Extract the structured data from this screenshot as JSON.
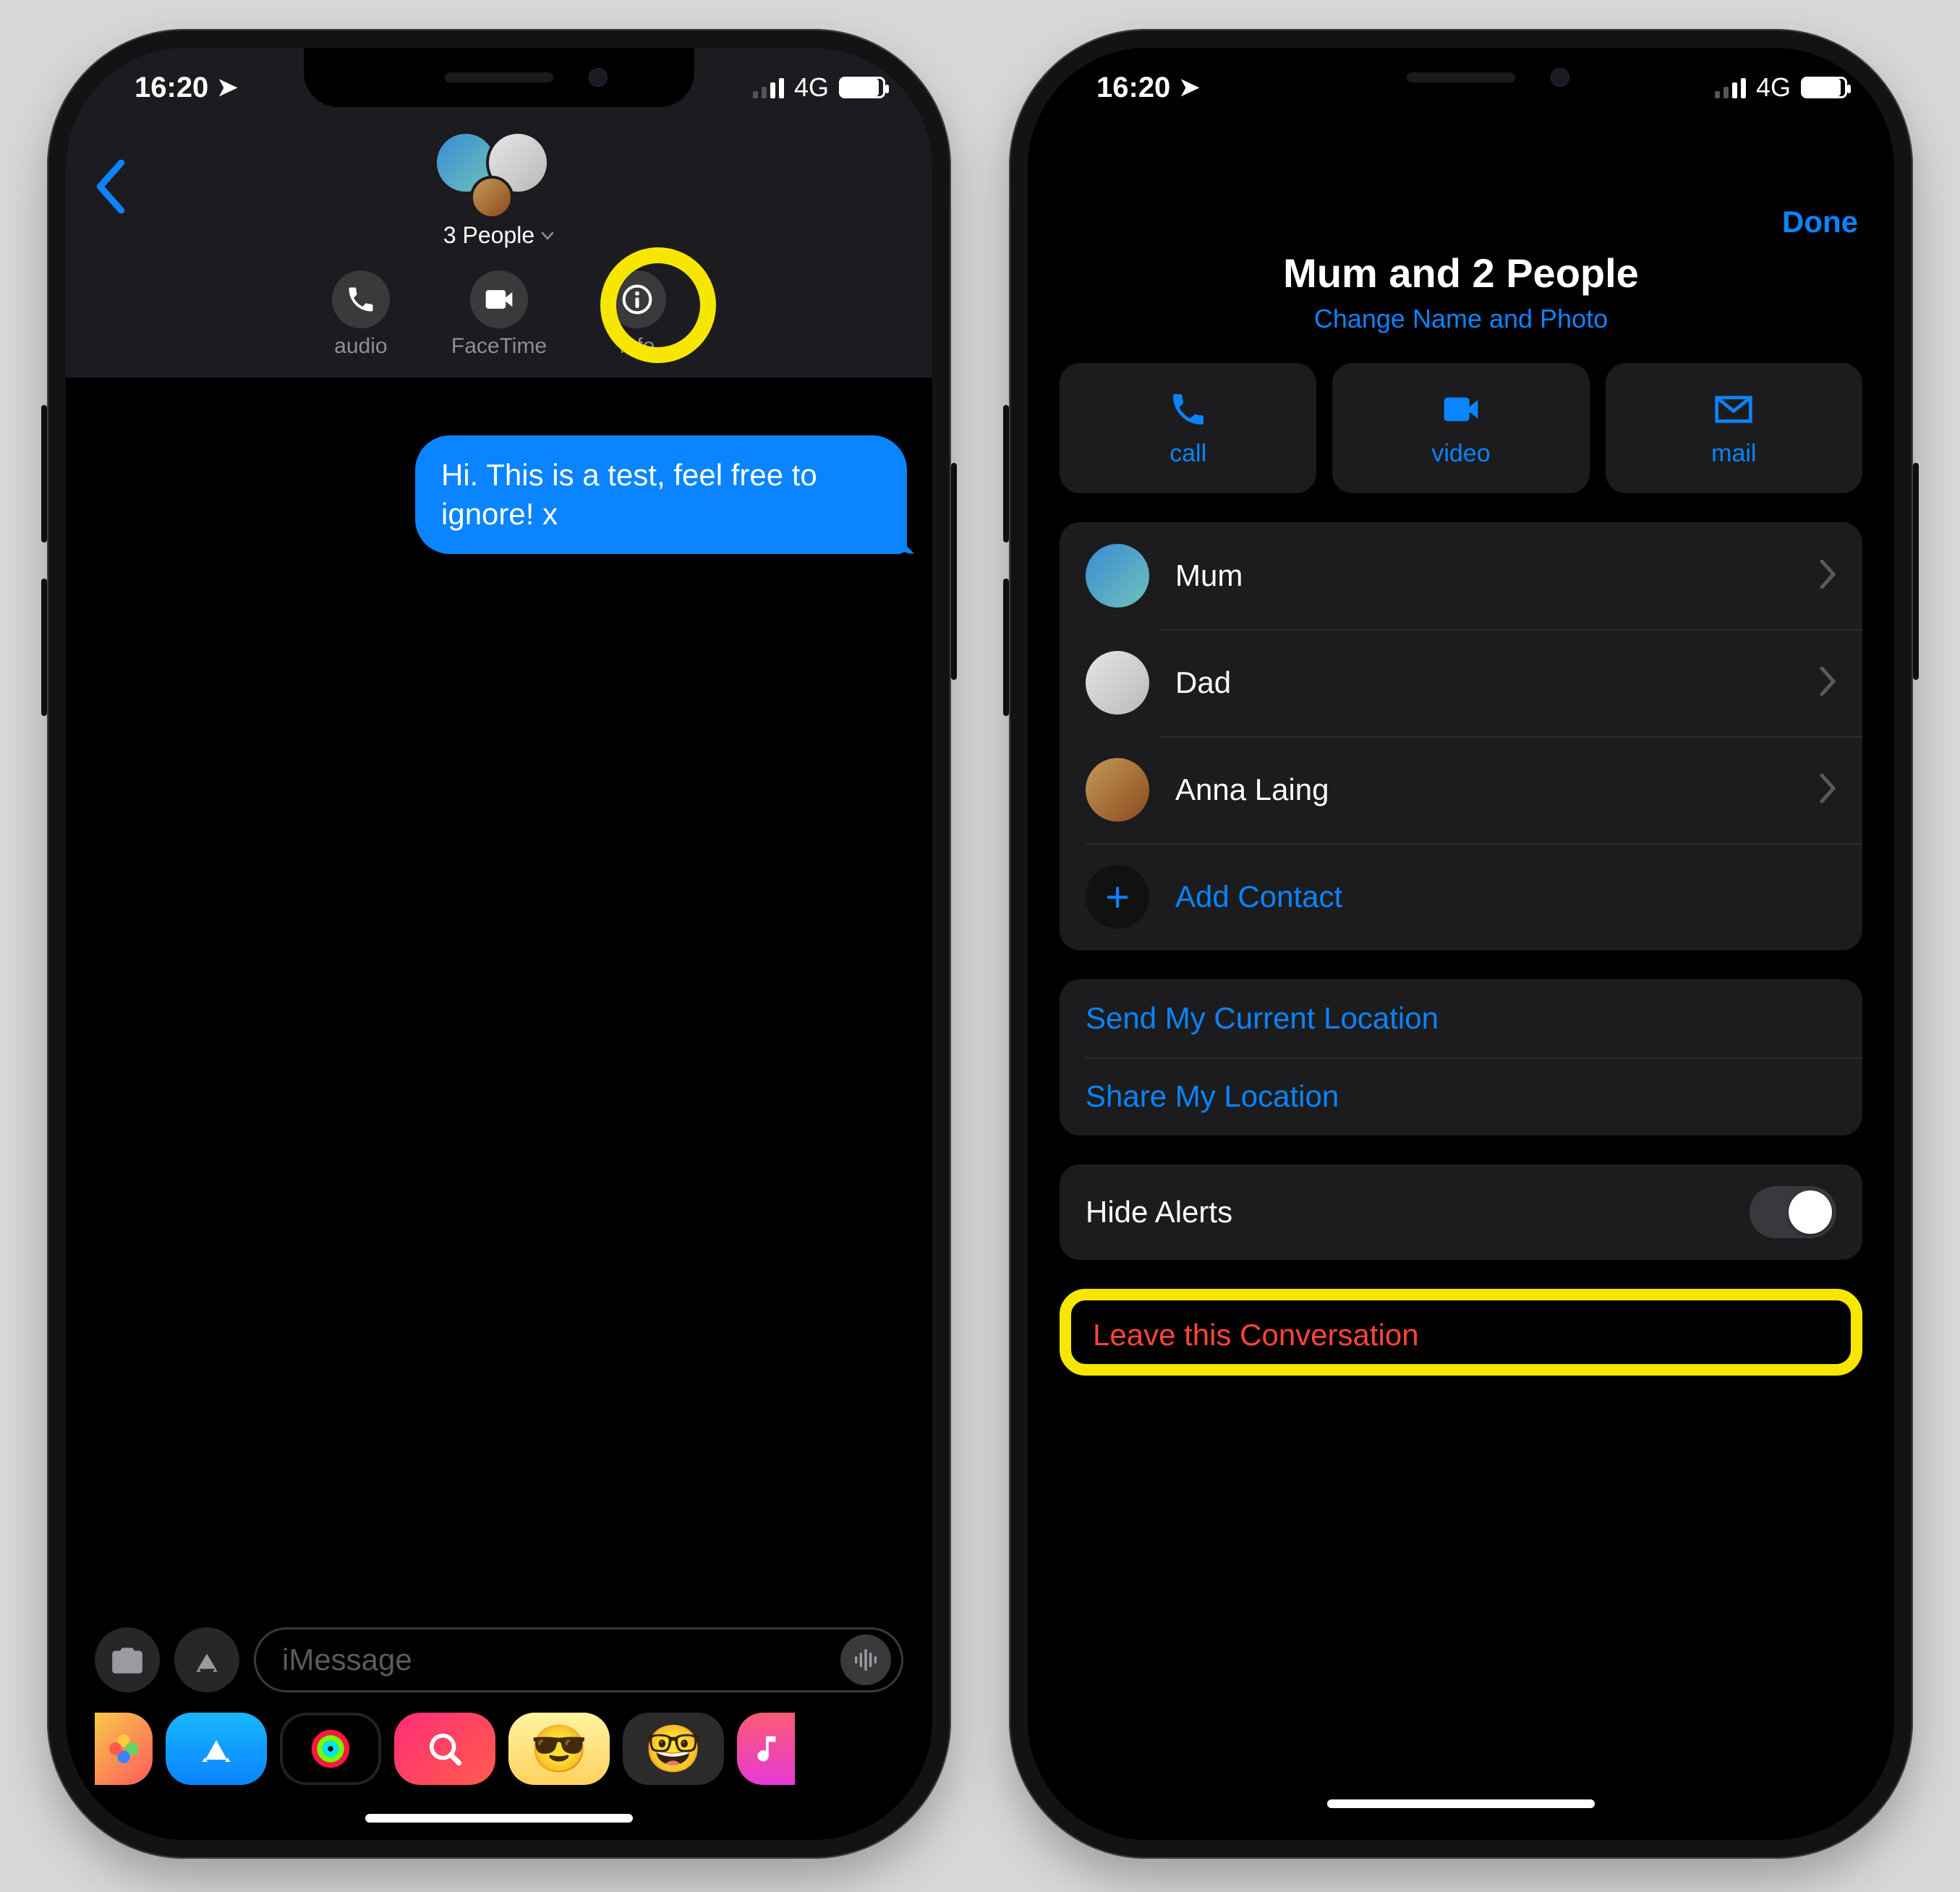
{
  "status": {
    "time": "16:20",
    "network": "4G"
  },
  "phone1": {
    "group_title": "3 People",
    "actions": {
      "audio": "audio",
      "facetime": "FaceTime",
      "info": "info"
    },
    "message": "Hi. This is a test, feel free to ignore! x",
    "input_placeholder": "iMessage"
  },
  "phone2": {
    "done": "Done",
    "title": "Mum and 2 People",
    "subtitle": "Change Name and Photo",
    "buttons": {
      "call": "call",
      "video": "video",
      "mail": "mail"
    },
    "members": [
      {
        "name": "Mum"
      },
      {
        "name": "Dad"
      },
      {
        "name": "Anna Laing"
      }
    ],
    "add_contact": "Add Contact",
    "send_location": "Send My Current Location",
    "share_location": "Share My Location",
    "hide_alerts": "Hide Alerts",
    "leave": "Leave this Conversation"
  }
}
